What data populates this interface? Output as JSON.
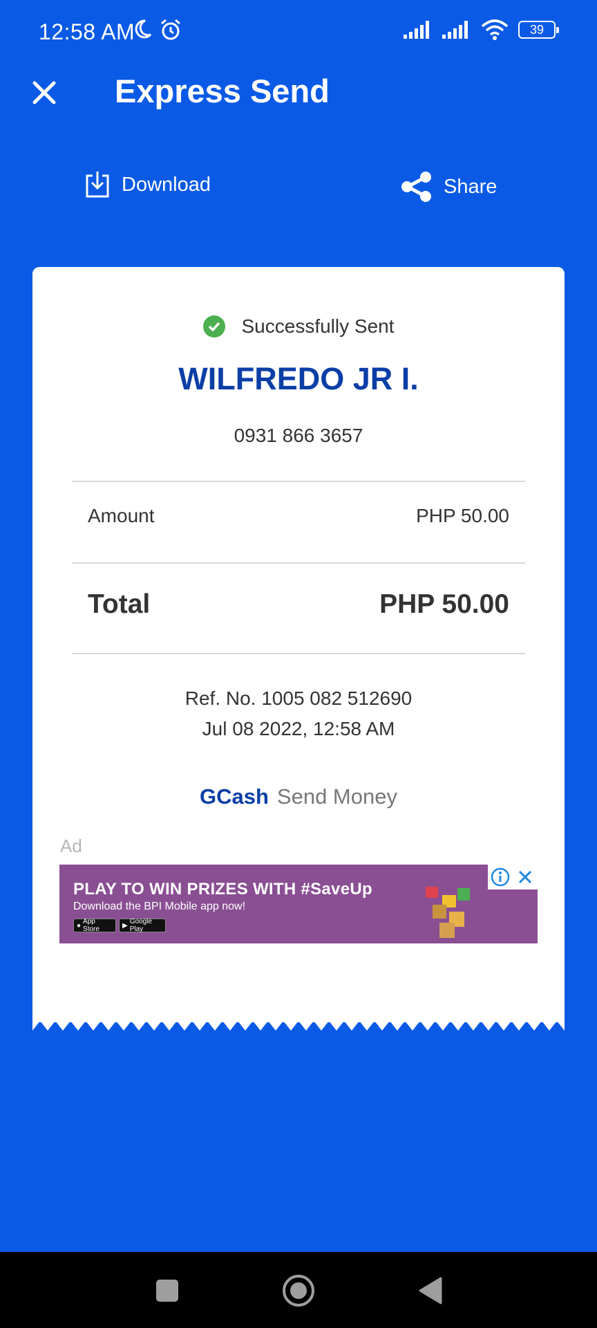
{
  "status_bar": {
    "time": "12:58 AM",
    "battery_level": "39",
    "icons": [
      "moon-icon",
      "alarm-icon",
      "signal-icon",
      "signal-icon",
      "wifi-icon",
      "battery-icon"
    ]
  },
  "header": {
    "title": "Express Send",
    "close_icon": "close-icon"
  },
  "actions": {
    "download_label": "Download",
    "download_icon": "download-icon",
    "share_label": "Share",
    "share_icon": "share-icon"
  },
  "receipt": {
    "status_text": "Successfully Sent",
    "status_icon": "check-circle-icon",
    "status_color": "#4caf50",
    "recipient_name": "WILFREDO JR I.",
    "recipient_number": "0931 866 3657",
    "amount_label": "Amount",
    "amount_value": "PHP 50.00",
    "total_label": "Total",
    "total_value": "PHP 50.00",
    "reference": "Ref. No. 1005 082 512690",
    "timestamp": "Jul 08 2022, 12:58 AM",
    "brand_name": "GCash",
    "brand_service": "Send Money"
  },
  "ad": {
    "label": "Ad",
    "headline": "PLAY TO WIN PRIZES WITH #SaveUp",
    "subtext": "Download the BPI Mobile app now!",
    "badges": [
      "App Store",
      "Google Play"
    ]
  },
  "colors": {
    "background": "#0a5ae6",
    "brand_blue": "#0b3ea6",
    "ad_purple": "#8a4f93"
  },
  "nav_bar": {
    "icons": [
      "recents-icon",
      "home-icon",
      "back-icon"
    ]
  }
}
